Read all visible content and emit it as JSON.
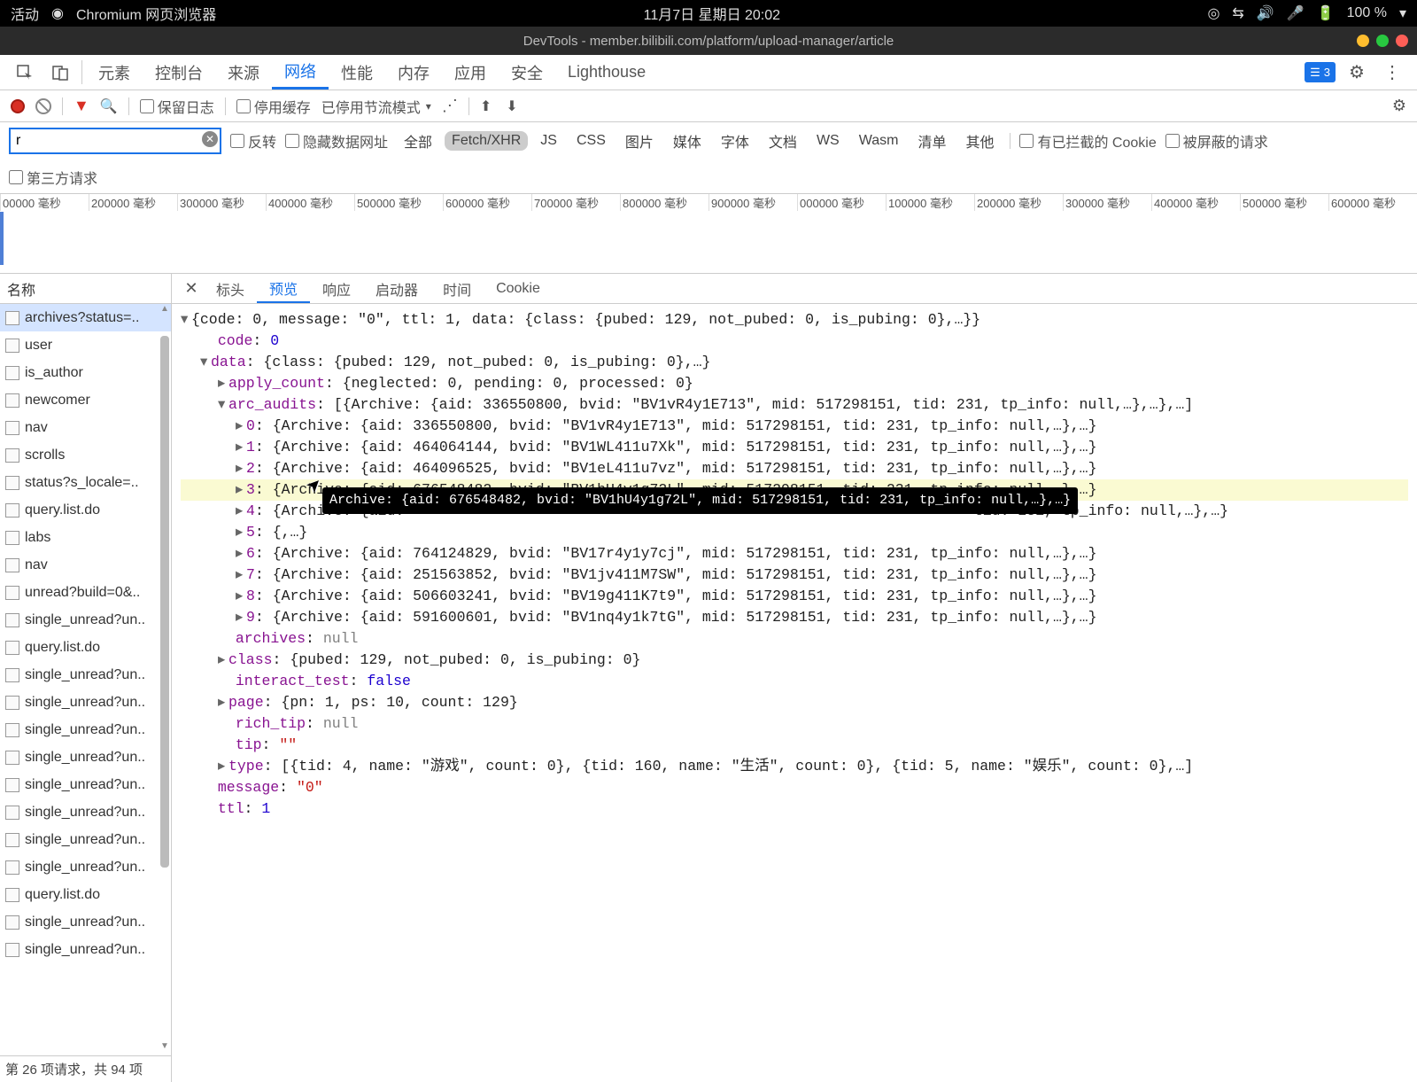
{
  "menubar": {
    "activity": "活动",
    "app_name": "Chromium 网页浏览器",
    "datetime": "11月7日 星期日 20:02",
    "battery": "100 %"
  },
  "titlebar": {
    "title": "DevTools - member.bilibili.com/platform/upload-manager/article"
  },
  "tabs": {
    "items": [
      "元素",
      "控制台",
      "来源",
      "网络",
      "性能",
      "内存",
      "应用",
      "安全",
      "Lighthouse"
    ],
    "active": "网络",
    "badge_count": "3"
  },
  "nettool": {
    "preserve_log": "保留日志",
    "disable_cache": "停用缓存",
    "throttle": "已停用节流模式"
  },
  "filterbar": {
    "filter_value": "r",
    "invert": "反转",
    "hide_data_urls": "隐藏数据网址",
    "types": [
      "全部",
      "Fetch/XHR",
      "JS",
      "CSS",
      "图片",
      "媒体",
      "字体",
      "文档",
      "WS",
      "Wasm",
      "清单",
      "其他"
    ],
    "active_type": "Fetch/XHR",
    "blocked_cookies": "有已拦截的 Cookie",
    "blocked_requests": "被屏蔽的请求",
    "third_party": "第三方请求"
  },
  "timeline_labels": [
    "00000 毫秒",
    "200000 毫秒",
    "300000 毫秒",
    "400000 毫秒",
    "500000 毫秒",
    "600000 毫秒",
    "700000 毫秒",
    "800000 毫秒",
    "900000 毫秒",
    "000000 毫秒",
    "100000 毫秒",
    "200000 毫秒",
    "300000 毫秒",
    "400000 毫秒",
    "500000 毫秒",
    "600000 毫秒"
  ],
  "requests": {
    "header": "名称",
    "selected": 0,
    "items": [
      "archives?status=..",
      "user",
      "is_author",
      "newcomer",
      "nav",
      "scrolls",
      "status?s_locale=..",
      "query.list.do",
      "labs",
      "nav",
      "unread?build=0&..",
      "single_unread?un..",
      "query.list.do",
      "single_unread?un..",
      "single_unread?un..",
      "single_unread?un..",
      "single_unread?un..",
      "single_unread?un..",
      "single_unread?un..",
      "single_unread?un..",
      "single_unread?un..",
      "query.list.do",
      "single_unread?un..",
      "single_unread?un.."
    ],
    "footer": "第 26 项请求，共 94 项"
  },
  "detail_tabs": {
    "items": [
      "标头",
      "预览",
      "响应",
      "启动器",
      "时间",
      "Cookie"
    ],
    "active": "预览"
  },
  "json": {
    "root_summary": "{code: 0, message: \"0\", ttl: 1, data: {class: {pubed: 129, not_pubed: 0, is_pubing: 0},…}}",
    "code": 0,
    "data_summary": "{class: {pubed: 129, not_pubed: 0, is_pubing: 0},…}",
    "apply_count_summary": "{neglected: 0, pending: 0, processed: 0}",
    "arc_audits_summary": "[{Archive: {aid: 336550800, bvid: \"BV1vR4y1E713\", mid: 517298151, tid: 231, tp_info: null,…},…},…]",
    "arc_audits": [
      "{Archive: {aid: 336550800, bvid: \"BV1vR4y1E713\", mid: 517298151, tid: 231, tp_info: null,…},…}",
      "{Archive: {aid: 464064144, bvid: \"BV1WL411u7Xk\", mid: 517298151, tid: 231, tp_info: null,…},…}",
      "{Archive: {aid: 464096525, bvid: \"BV1eL411u7vz\", mid: 517298151, tid: 231, tp_info: null,…},…}",
      "{Archive: {aid: 676548482, bvid: \"BV1hU4y1g72L\", mid: 517298151, tid: 231, tp_info: null,…},…}",
      "{Archive: {aid: ",
      "{,…}",
      "{Archive: {aid: 764124829, bvid: \"BV17r4y1y7cj\", mid: 517298151, tid: 231, tp_info: null,…},…}",
      "{Archive: {aid: 251563852, bvid: \"BV1jv411M7SW\", mid: 517298151, tid: 231, tp_info: null,…},…}",
      "{Archive: {aid: 506603241, bvid: \"BV19g411K7t9\", mid: 517298151, tid: 231, tp_info: null,…},…}",
      "{Archive: {aid: 591600601, bvid: \"BV1nq4y1k7tG\", mid: 517298151, tid: 231, tp_info: null,…},…}"
    ],
    "row4_tail": "tid: 231, tp_info: null,…},…}",
    "archives": "null",
    "class_summary": "{pubed: 129, not_pubed: 0, is_pubing: 0}",
    "interact_test": "false",
    "page_summary": "{pn: 1, ps: 10, count: 129}",
    "rich_tip": "null",
    "tip": "\"\"",
    "type_summary": "[{tid: 4, name: \"游戏\", count: 0}, {tid: 160, name: \"生活\", count: 0}, {tid: 5, name: \"娱乐\", count: 0},…]",
    "message": "\"0\"",
    "ttl": 1
  },
  "tooltip": "Archive: {aid: 676548482, bvid: \"BV1hU4y1g72L\", mid: 517298151, tid: 231, tp_info: null,…},…}"
}
